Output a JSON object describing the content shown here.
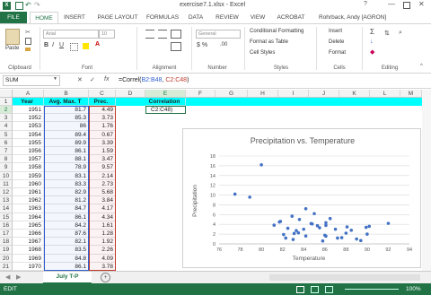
{
  "window": {
    "title": "exercise7.1.xlsx - Excel",
    "user": "Rohrback, Andy [AGRON]"
  },
  "tabs": [
    "FILE",
    "HOME",
    "INSERT",
    "PAGE LAYOUT",
    "FORMULAS",
    "DATA",
    "REVIEW",
    "VIEW",
    "ACROBAT"
  ],
  "ribbon": {
    "paste": "Paste",
    "clipboard": "Clipboard",
    "font_name": "Arial",
    "font_size": "10",
    "font": "Font",
    "alignment": "Alignment",
    "number_format": "General",
    "number": "Number",
    "cond_format": "Conditional Formatting",
    "format_table": "Format as Table",
    "cell_styles": "Cell Styles",
    "styles": "Styles",
    "insert": "Insert",
    "delete": "Delete",
    "format": "Format",
    "cells": "Cells",
    "editing": "Editing"
  },
  "formula_bar": {
    "name_box": "SUM",
    "cancel": "✕",
    "enter": "✓",
    "fx": "fx",
    "prefix": "=Correl(",
    "ref1": "B2:B48",
    "sep": ", ",
    "ref2": "C2:C48",
    "suffix": ")"
  },
  "columns": [
    "A",
    "B",
    "C",
    "D",
    "E",
    "F",
    "G",
    "H",
    "I",
    "J",
    "K",
    "L",
    "M"
  ],
  "headers": {
    "year": "Year",
    "avg_max_t": "Avg. Max. T",
    "prec": "Prec.",
    "correlation": "Correlation"
  },
  "edit_cell": "C2:C48)",
  "rows": [
    {
      "n": "2",
      "year": "1951",
      "t": "81.7",
      "p": "4.49"
    },
    {
      "n": "3",
      "year": "1952",
      "t": "85.3",
      "p": "3.73"
    },
    {
      "n": "4",
      "year": "1953",
      "t": "86",
      "p": "1.76"
    },
    {
      "n": "5",
      "year": "1954",
      "t": "89.4",
      "p": "0.67"
    },
    {
      "n": "6",
      "year": "1955",
      "t": "89.9",
      "p": "3.39"
    },
    {
      "n": "7",
      "year": "1956",
      "t": "86.1",
      "p": "1.59"
    },
    {
      "n": "8",
      "year": "1957",
      "t": "88.1",
      "p": "3.47"
    },
    {
      "n": "9",
      "year": "1958",
      "t": "78.9",
      "p": "9.57"
    },
    {
      "n": "10",
      "year": "1959",
      "t": "83.1",
      "p": "2.14"
    },
    {
      "n": "11",
      "year": "1960",
      "t": "83.3",
      "p": "2.73"
    },
    {
      "n": "12",
      "year": "1961",
      "t": "82.9",
      "p": "5.68"
    },
    {
      "n": "13",
      "year": "1962",
      "t": "81.2",
      "p": "3.84"
    },
    {
      "n": "14",
      "year": "1963",
      "t": "84.7",
      "p": "4.17"
    },
    {
      "n": "15",
      "year": "1964",
      "t": "86.1",
      "p": "4.34"
    },
    {
      "n": "16",
      "year": "1965",
      "t": "84.2",
      "p": "1.61"
    },
    {
      "n": "17",
      "year": "1966",
      "t": "87.6",
      "p": "1.28"
    },
    {
      "n": "18",
      "year": "1967",
      "t": "82.1",
      "p": "1.92"
    },
    {
      "n": "19",
      "year": "1968",
      "t": "83.5",
      "p": "2.26"
    },
    {
      "n": "20",
      "year": "1969",
      "t": "84.8",
      "p": "4.09"
    },
    {
      "n": "21",
      "year": "1970",
      "t": "86.1",
      "p": "3.78"
    }
  ],
  "sheet_tab": "July T-P",
  "status": {
    "mode": "EDIT",
    "zoom": "100%"
  },
  "chart_data": {
    "type": "scatter",
    "title": "Precipitation vs. Temperature",
    "xlabel": "Temperature",
    "ylabel": "Precipitation",
    "xlim": [
      76,
      94
    ],
    "ylim": [
      0,
      18
    ],
    "xticks": [
      "76",
      "78",
      "80",
      "82",
      "84",
      "86",
      "88",
      "90",
      "92",
      "94"
    ],
    "yticks": [
      "0",
      "2",
      "4",
      "6",
      "8",
      "10",
      "12",
      "14",
      "16",
      "18"
    ],
    "grid": true,
    "points": [
      [
        81.7,
        4.49
      ],
      [
        85.3,
        3.73
      ],
      [
        86,
        1.76
      ],
      [
        89.4,
        0.67
      ],
      [
        89.9,
        3.39
      ],
      [
        86.1,
        1.59
      ],
      [
        88.1,
        3.47
      ],
      [
        78.9,
        9.57
      ],
      [
        83.1,
        2.14
      ],
      [
        83.3,
        2.73
      ],
      [
        82.9,
        5.68
      ],
      [
        81.2,
        3.84
      ],
      [
        84.7,
        4.17
      ],
      [
        86.1,
        4.34
      ],
      [
        84.2,
        1.61
      ],
      [
        87.6,
        1.28
      ],
      [
        82.1,
        1.92
      ],
      [
        83.5,
        2.26
      ],
      [
        84.8,
        4.09
      ],
      [
        86.1,
        3.78
      ],
      [
        80,
        16.2
      ],
      [
        77.5,
        10.2
      ],
      [
        81.8,
        4.6
      ],
      [
        82.5,
        3.2
      ],
      [
        83.6,
        5.0
      ],
      [
        84.2,
        7.2
      ],
      [
        85,
        6.2
      ],
      [
        85.5,
        3.3
      ],
      [
        86.5,
        5.2
      ],
      [
        87,
        3.0
      ],
      [
        88,
        2.2
      ],
      [
        88.5,
        2.8
      ],
      [
        90,
        2.0
      ],
      [
        92,
        4.2
      ],
      [
        90.2,
        3.6
      ],
      [
        82.3,
        1.2
      ],
      [
        83,
        0.9
      ],
      [
        85.8,
        0.6
      ],
      [
        87.2,
        1.2
      ],
      [
        89,
        1.0
      ],
      [
        84,
        3.0
      ]
    ]
  }
}
